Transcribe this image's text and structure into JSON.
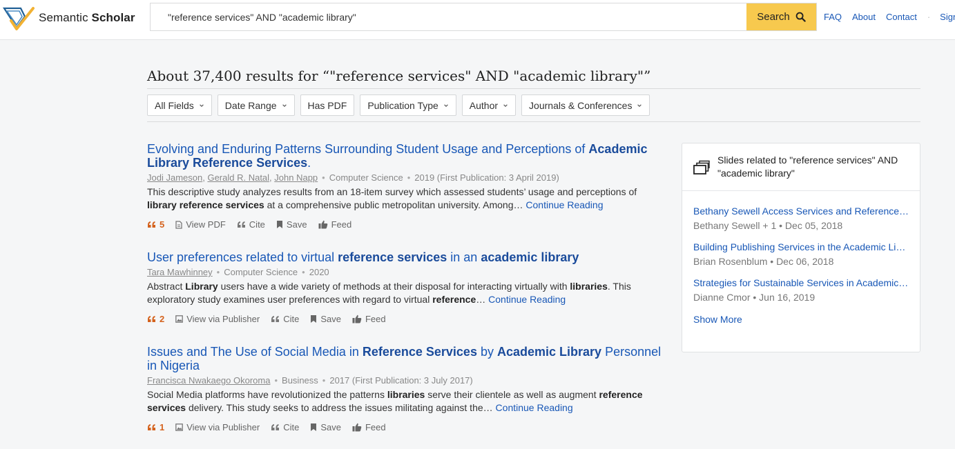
{
  "header": {
    "logo_text_light": "Semantic ",
    "logo_text_bold": "Scholar",
    "search_value": "\"reference services\" AND \"academic library\"",
    "search_button": "Search",
    "nav": [
      "FAQ",
      "About",
      "Contact",
      "Sign In"
    ],
    "nav_separator": "·"
  },
  "results_heading": "About 37,400 results for “\"reference services\" AND \"academic library\"”",
  "filters": [
    "All Fields",
    "Date Range",
    "Has PDF",
    "Publication Type",
    "Author",
    "Journals & Conferences"
  ],
  "results": [
    {
      "title_parts": [
        {
          "t": "Evolving and Enduring Patterns Surrounding Student Usage and Perceptions of ",
          "b": false
        },
        {
          "t": "Academic Library Reference Services",
          "b": true
        },
        {
          "t": ".",
          "b": false
        }
      ],
      "authors": [
        "Jodi Jameson",
        "Gerald R. Natal",
        "John Napp"
      ],
      "field": "Computer Science",
      "date": "2019 (First Publication: 3 April 2019)",
      "abstract_parts": [
        {
          "t": "This descriptive study analyzes results from an 18-item survey which assessed students’ usage and perceptions of ",
          "b": false
        },
        {
          "t": "library reference services",
          "b": true
        },
        {
          "t": " at a comprehensive public metropolitan university. Among… ",
          "b": false
        }
      ],
      "continue": "Continue Reading",
      "citations": "5",
      "actions": [
        "View PDF",
        "Cite",
        "Save",
        "Feed"
      ]
    },
    {
      "title_parts": [
        {
          "t": "User preferences related to virtual ",
          "b": false
        },
        {
          "t": "reference services",
          "b": true
        },
        {
          "t": " in an ",
          "b": false
        },
        {
          "t": "academic library",
          "b": true
        }
      ],
      "authors": [
        "Tara Mawhinney"
      ],
      "field": "Computer Science",
      "date": "2020",
      "abstract_parts": [
        {
          "t": "Abstract ",
          "b": false
        },
        {
          "t": "Library",
          "b": true
        },
        {
          "t": " users have a wide variety of methods at their disposal for interacting virtually with ",
          "b": false
        },
        {
          "t": "libraries",
          "b": true
        },
        {
          "t": ". This exploratory study examines user preferences with regard to virtual ",
          "b": false
        },
        {
          "t": "reference",
          "b": true
        },
        {
          "t": "… ",
          "b": false
        }
      ],
      "continue": "Continue Reading",
      "citations": "2",
      "actions": [
        "View via Publisher",
        "Cite",
        "Save",
        "Feed"
      ]
    },
    {
      "title_parts": [
        {
          "t": "Issues and The Use of Social Media in ",
          "b": false
        },
        {
          "t": "Reference Services",
          "b": true
        },
        {
          "t": " by ",
          "b": false
        },
        {
          "t": "Academic Library",
          "b": true
        },
        {
          "t": " Personnel in Nigeria",
          "b": false
        }
      ],
      "authors": [
        "Francisca Nwakaego Okoroma"
      ],
      "field": "Business",
      "date": "2017 (First Publication: 3 July 2017)",
      "abstract_parts": [
        {
          "t": "Social Media platforms have revolutionized the patterns ",
          "b": false
        },
        {
          "t": "libraries",
          "b": true
        },
        {
          "t": " serve their clientele as well as augment ",
          "b": false
        },
        {
          "t": "reference services",
          "b": true
        },
        {
          "t": " delivery. This study seeks to address the issues militating against the… ",
          "b": false
        }
      ],
      "continue": "Continue Reading",
      "citations": "1",
      "actions": [
        "View via Publisher",
        "Cite",
        "Save",
        "Feed"
      ]
    }
  ],
  "slides": {
    "title": "Slides related to \"reference services\" AND \"academic library\"",
    "items": [
      {
        "title": "Bethany Sewell Access Services and Reference Librarian",
        "meta": "Bethany Sewell + 1 • Dec 05, 2018"
      },
      {
        "title": "Building Publishing Services in the Academic Library",
        "meta": "Brian Rosenblum • Dec 06, 2018"
      },
      {
        "title": "Strategies for Sustainable Services in Academic Libraries",
        "meta": "Dianne Cmor • Jun 16, 2019"
      }
    ],
    "show_more": "Show More"
  },
  "colors": {
    "accent_link": "#1857b6",
    "search_button": "#f7c94e",
    "citation": "#d4621d",
    "background": "#f5f6f7"
  },
  "icons": {
    "logo": "semantic-scholar-logo",
    "search": "search-icon",
    "chevron": "chevron-down-icon",
    "citation": "quote-icon",
    "pdf": "document-icon",
    "publisher": "image-icon",
    "cite": "quote-icon",
    "save": "bookmark-icon",
    "feed": "thumbs-up-icon",
    "slides": "slides-icon"
  }
}
